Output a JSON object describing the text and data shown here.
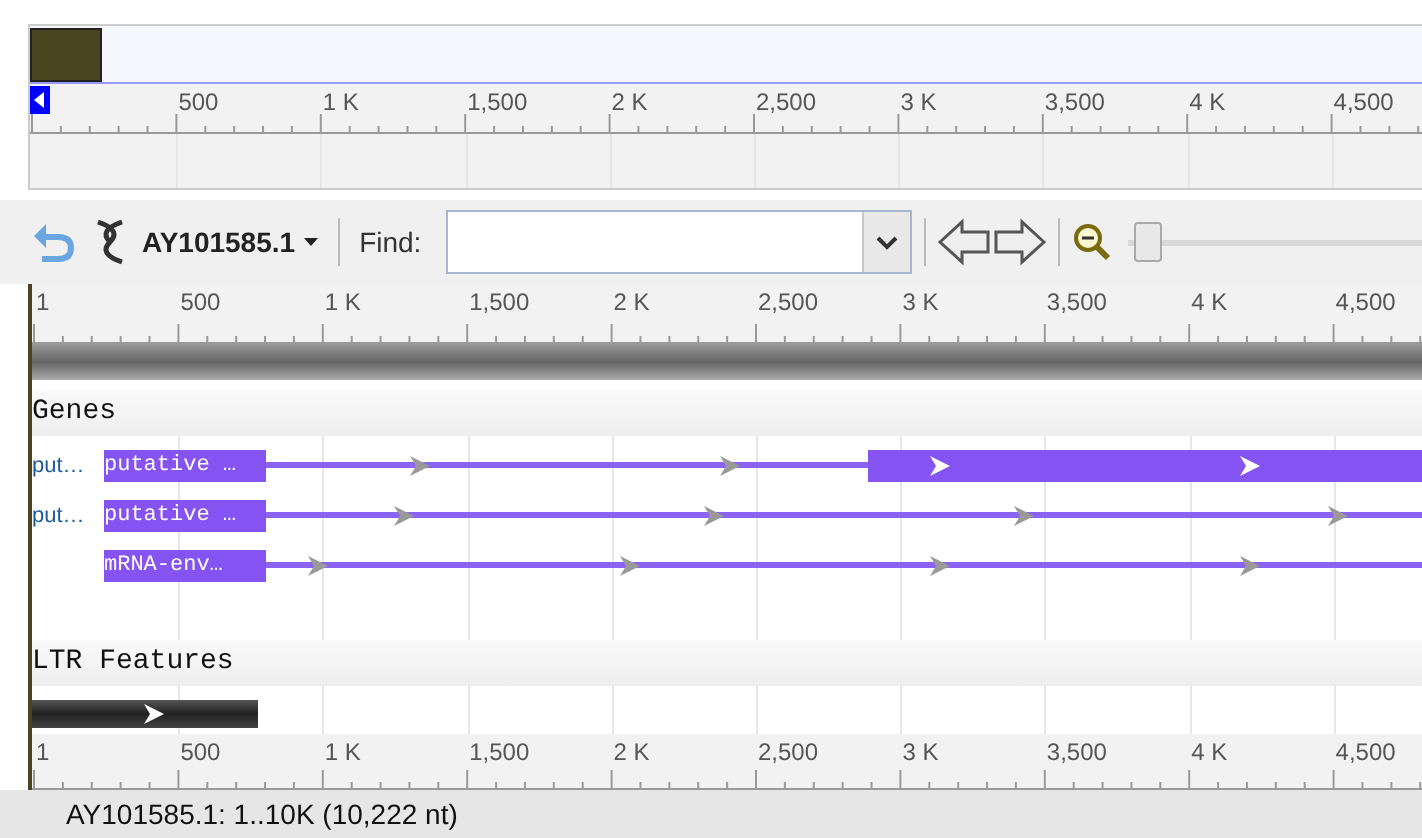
{
  "overview": {
    "rulers_labels": [
      "500",
      "1 K",
      "1,500",
      "2 K",
      "2,500",
      "3 K",
      "3,500",
      "4 K",
      "4,500"
    ]
  },
  "toolbar": {
    "sequence": "AY101585.1",
    "find_label": "Find:",
    "zoom": {
      "level": 0.02
    }
  },
  "ruler": {
    "labels": [
      "1",
      "500",
      "1 K",
      "1,500",
      "2 K",
      "2,500",
      "3 K",
      "3,500",
      "4 K",
      "4,500"
    ]
  },
  "tracks": [
    {
      "title": "Genes",
      "features": [
        {
          "kind": "transcript",
          "outer_label": "put…",
          "name": "putative …"
        },
        {
          "kind": "transcript",
          "outer_label": "put…",
          "name": "putative …"
        },
        {
          "kind": "transcript",
          "name": "mRNA-env…"
        }
      ]
    },
    {
      "title": "LTR Features",
      "features": [
        {
          "kind": "ltr"
        }
      ]
    }
  ],
  "bottom_ruler": {
    "labels": [
      "1",
      "500",
      "1 K",
      "1,500",
      "2 K",
      "2,500",
      "3 K",
      "3,500",
      "4 K",
      "4,500"
    ]
  },
  "status_bar": {
    "text": "AY101585.1: 1..10K (10,222 nt)"
  }
}
